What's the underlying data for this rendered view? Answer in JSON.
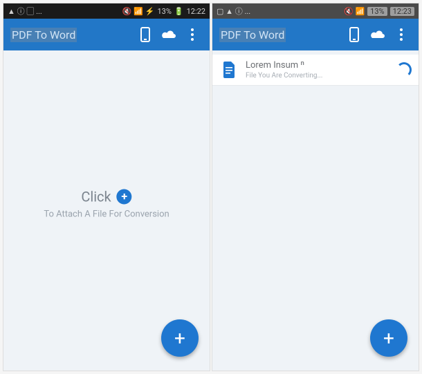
{
  "left": {
    "status": {
      "icons_left": "▲ ⓘ ▢ ...",
      "icons_right": "🔇 📶 ⚡",
      "battery": "13%",
      "time": "12:22"
    },
    "app_title": "PDF To Word",
    "empty": {
      "click": "Click",
      "subtitle": "To Attach A File For Conversion"
    }
  },
  "right": {
    "status": {
      "icons_left": "▢ ▲ ⓘ ...",
      "icons_right": "🔇 📶",
      "battery": "13%",
      "time": "12:23"
    },
    "app_title": "PDF To Word",
    "file": {
      "name": "Lorem Insum ⁿ",
      "status": "File You Are Converting..."
    }
  }
}
